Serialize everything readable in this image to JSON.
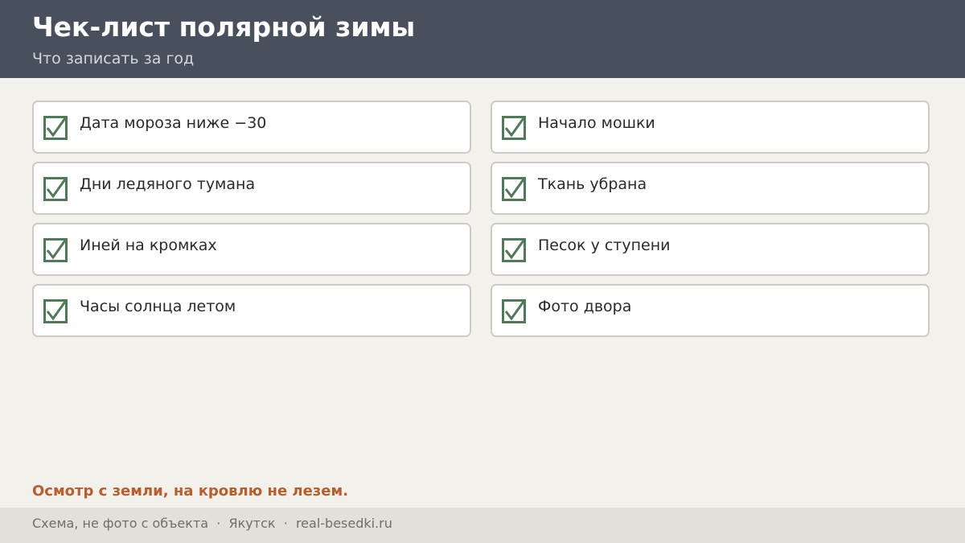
{
  "header": {
    "title": "Чек-лист полярной зимы",
    "subtitle": "Что записать за год"
  },
  "checklist": {
    "left": [
      {
        "label": "Дата мороза ниже −30",
        "checked": true,
        "icon": "checkmark-icon"
      },
      {
        "label": "Дни ледяного тумана",
        "checked": true,
        "icon": "checkmark-icon"
      },
      {
        "label": "Иней на кромках",
        "checked": true,
        "icon": "checkmark-icon"
      },
      {
        "label": "Часы солнца летом",
        "checked": true,
        "icon": "checkmark-icon"
      }
    ],
    "right": [
      {
        "label": "Начало мошки",
        "checked": true,
        "icon": "checkmark-icon"
      },
      {
        "label": "Ткань убрана",
        "checked": true,
        "icon": "checkmark-icon"
      },
      {
        "label": "Песок у ступени",
        "checked": true,
        "icon": "checkmark-icon"
      },
      {
        "label": "Фото двора",
        "checked": true,
        "icon": "checkmark-icon"
      }
    ]
  },
  "warning": "Осмотр с земли, на кровлю не лезем.",
  "footer": {
    "text": "Схема, не фото с объекта  ·  Якутск  ·  real-besedki.ru"
  },
  "colors": {
    "header_bg": "#47505c",
    "page_bg": "#f3f1ec",
    "check_green": "#4f7a57",
    "warning": "#b85d2c",
    "footer_bg": "#e3e0da"
  }
}
